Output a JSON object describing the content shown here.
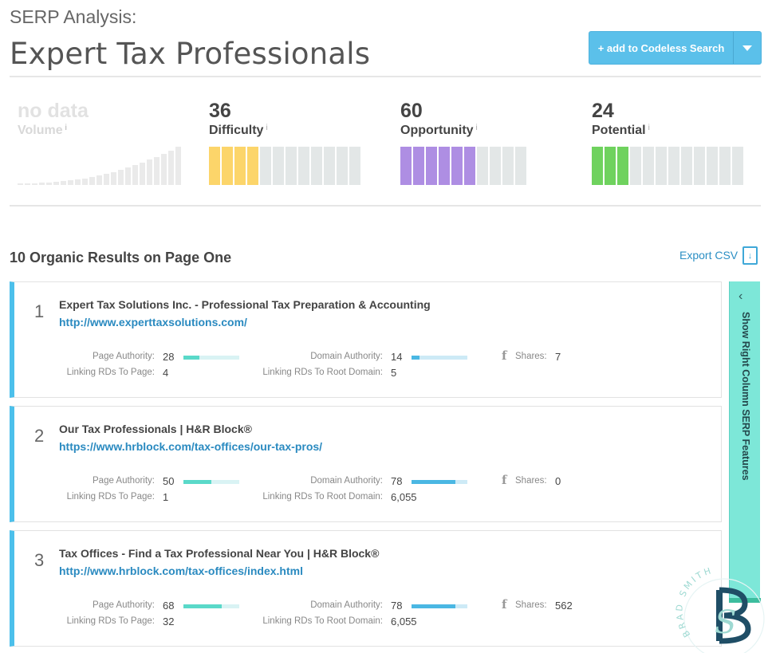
{
  "header": {
    "subtitle": "SERP Analysis:",
    "title": "Expert Tax Professionals",
    "add_button_label": "+ add to Codeless Search"
  },
  "metrics": [
    {
      "value": "no data",
      "label": "Volume",
      "info": "i",
      "filled": 0,
      "segments": 0,
      "color": "#e8e8e8"
    },
    {
      "value": "36",
      "label": "Difficulty",
      "info": "i",
      "filled": 4,
      "segments": 12,
      "color": "#fcd56a"
    },
    {
      "value": "60",
      "label": "Opportunity",
      "info": "i",
      "filled": 6,
      "segments": 10,
      "color": "#ae8ee3"
    },
    {
      "value": "24",
      "label": "Potential",
      "info": "i",
      "filled": 3,
      "segments": 12,
      "color": "#6fd25e"
    }
  ],
  "results_section": {
    "title": "10 Organic Results on Page One",
    "export_label": "Export CSV",
    "export_icon": "download-icon"
  },
  "stat_labels": {
    "page_authority": "Page Authority:",
    "linking_rds_page": "Linking RDs To Page:",
    "domain_authority": "Domain Authority:",
    "linking_rds_root": "Linking RDs To Root Domain:",
    "shares": "Shares:",
    "facebook_glyph": "f"
  },
  "results": [
    {
      "rank": "1",
      "title": "Expert Tax Solutions Inc. - Professional Tax Preparation & Accounting",
      "url": "http://www.experttaxsolutions.com/",
      "page_authority": "28",
      "page_authority_pct": 28,
      "linking_rds_page": "4",
      "domain_authority": "14",
      "domain_authority_pct": 14,
      "linking_rds_root": "5",
      "shares": "7"
    },
    {
      "rank": "2",
      "title": "Our Tax Professionals | H&R Block®",
      "url": "https://www.hrblock.com/tax-offices/our-tax-pros/",
      "page_authority": "50",
      "page_authority_pct": 50,
      "linking_rds_page": "1",
      "domain_authority": "78",
      "domain_authority_pct": 78,
      "linking_rds_root": "6,055",
      "shares": "0"
    },
    {
      "rank": "3",
      "title": "Tax Offices - Find a Tax Professional Near You | H&R Block®",
      "url": "http://www.hrblock.com/tax-offices/index.html",
      "page_authority": "68",
      "page_authority_pct": 68,
      "linking_rds_page": "32",
      "domain_authority": "78",
      "domain_authority_pct": 78,
      "linking_rds_root": "6,055",
      "shares": "562"
    }
  ],
  "side_panel": {
    "label": "Show Right Column SERP Features",
    "chevron": "‹"
  },
  "watermark": {
    "text": "BRAD SMITH"
  }
}
